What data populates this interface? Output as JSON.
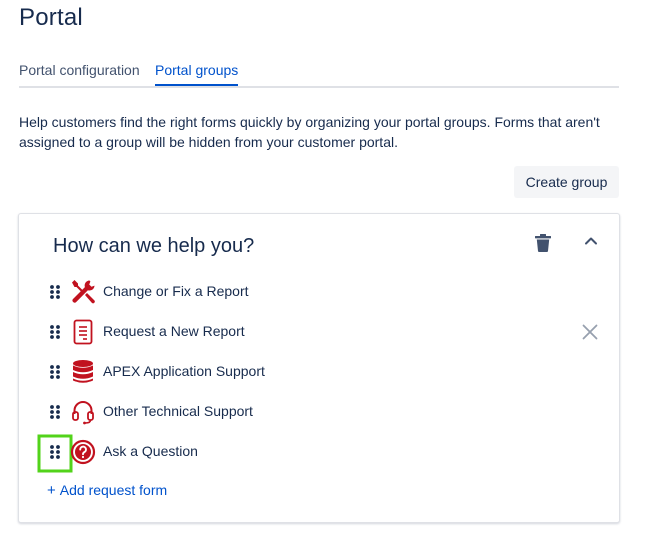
{
  "page": {
    "title": "Portal"
  },
  "tabs": [
    {
      "label": "Portal configuration",
      "selected": false
    },
    {
      "label": "Portal groups",
      "selected": true
    }
  ],
  "help_text": "Help customers find the right forms quickly by organizing your portal groups. Forms that aren't assigned to a group will be hidden from your customer portal.",
  "create_group_label": "Create group",
  "group": {
    "title": "How can we help you?",
    "items": [
      {
        "label": "Change or Fix a Report",
        "icon": "tools-icon"
      },
      {
        "label": "Request a New Report",
        "icon": "document-icon"
      },
      {
        "label": "APEX Application Support",
        "icon": "database-icon"
      },
      {
        "label": "Other Technical Support",
        "icon": "headset-icon"
      },
      {
        "label": "Ask a Question",
        "icon": "question-icon"
      }
    ],
    "add_label": "Add request form"
  },
  "colors": {
    "accent": "#0052cc",
    "icon_red": "#c1121f",
    "highlight": "#52d31a",
    "text": "#172b4d"
  }
}
